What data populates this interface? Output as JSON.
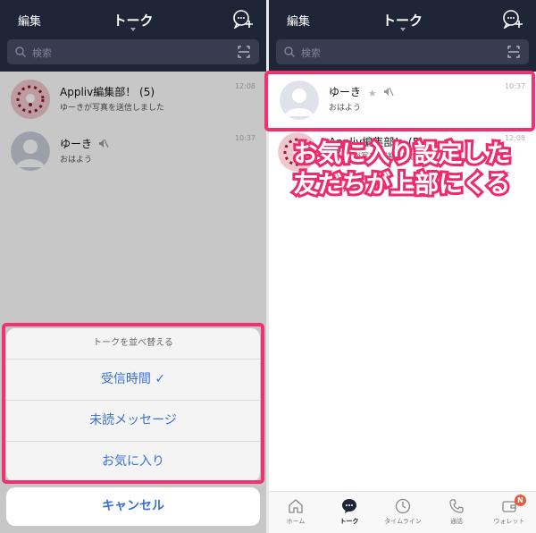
{
  "header": {
    "edit_label": "編集",
    "title": "トーク",
    "search_placeholder": "検索"
  },
  "left": {
    "chats": [
      {
        "name": "Appliv編集部！ (5)",
        "preview": "ゆーきが写真を送信しました",
        "time": "12:08"
      },
      {
        "name": "ゆーき",
        "preview": "おはよう",
        "time": "10:37"
      }
    ],
    "sort_sheet": {
      "title": "トークを並べ替える",
      "options": [
        "受信時間 ✓",
        "未読メッセージ",
        "お気に入り"
      ],
      "cancel": "キャンセル"
    }
  },
  "right": {
    "chats": [
      {
        "name": "ゆーき",
        "preview": "おはよう",
        "time": "10:37"
      },
      {
        "name": "Appliv編集部！ (5)",
        "preview": "ゆーきが写真を送信しました",
        "time": "12:08"
      }
    ],
    "annotation_line1": "お気に入り設定した",
    "annotation_line2": "友だちが上部にくる",
    "tabs": [
      "ホーム",
      "トーク",
      "タイムライン",
      "通話",
      "ウォレット"
    ],
    "wallet_badge": "N"
  },
  "colors": {
    "header_bg": "#1e2536",
    "accent_blue": "#3a70d6",
    "highlight_pink": "#f0336e"
  }
}
